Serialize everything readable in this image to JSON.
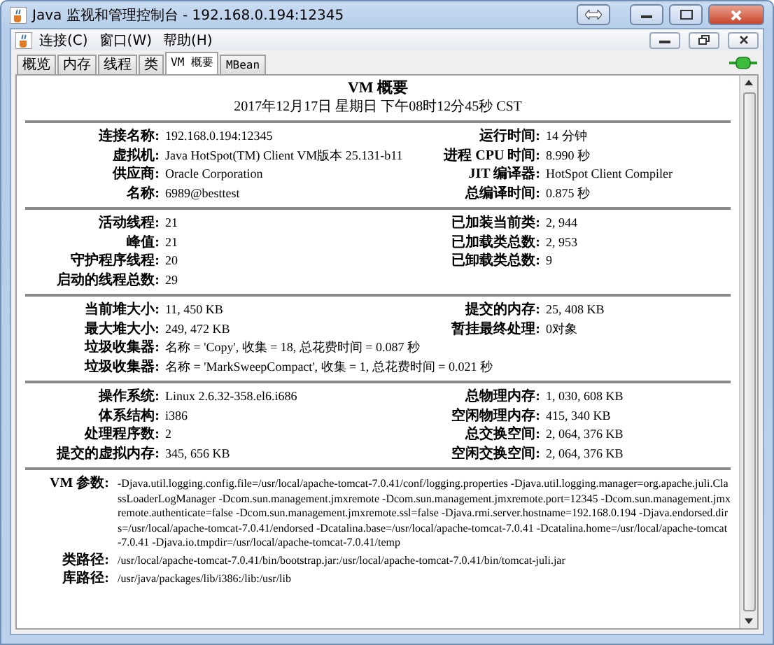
{
  "window": {
    "title": "Java 监视和管理控制台 - 192.168.0.194:12345"
  },
  "menu": [
    {
      "label": "连接(C)"
    },
    {
      "label": "窗口(W)"
    },
    {
      "label": "帮助(H)"
    }
  ],
  "tabs": [
    {
      "label": "概览",
      "selected": false
    },
    {
      "label": "内存",
      "selected": false
    },
    {
      "label": "线程",
      "selected": false
    },
    {
      "label": "类",
      "selected": false
    },
    {
      "label": "VM 概要",
      "selected": true
    },
    {
      "label": "MBean",
      "selected": false
    }
  ],
  "summary": {
    "title": "VM 概要",
    "timestamp": "2017年12月17日 星期日 下午08时12分45秒 CST",
    "sections": [
      {
        "rows": [
          {
            "kind": "pair",
            "left": {
              "label": "连接名称:",
              "value": "192.168.0.194:12345"
            },
            "right": {
              "label": "运行时间:",
              "value": "14 分钟"
            }
          },
          {
            "kind": "pair",
            "left": {
              "label": "虚拟机:",
              "value": "Java HotSpot(TM) Client VM版本 25.131-b11"
            },
            "right": {
              "label": "进程 CPU 时间:",
              "value": "8.990 秒"
            }
          },
          {
            "kind": "pair",
            "left": {
              "label": "供应商:",
              "value": "Oracle Corporation"
            },
            "right": {
              "label": "JIT 编译器:",
              "value": "HotSpot Client Compiler"
            }
          },
          {
            "kind": "pair",
            "left": {
              "label": "名称:",
              "value": "6989@besttest"
            },
            "right": {
              "label": "总编译时间:",
              "value": "0.875 秒"
            }
          }
        ]
      },
      {
        "rows": [
          {
            "kind": "pair",
            "left": {
              "label": "活动线程:",
              "value": "21"
            },
            "right": {
              "label": "已加装当前类:",
              "value": "2, 944"
            }
          },
          {
            "kind": "pair",
            "left": {
              "label": "峰值:",
              "value": "21"
            },
            "right": {
              "label": "已加载类总数:",
              "value": "2, 953"
            }
          },
          {
            "kind": "pair",
            "left": {
              "label": "守护程序线程:",
              "value": "20"
            },
            "right": {
              "label": "已卸载类总数:",
              "value": "9"
            }
          },
          {
            "kind": "pair",
            "left": {
              "label": "启动的线程总数:",
              "value": "29"
            }
          }
        ]
      },
      {
        "rows": [
          {
            "kind": "pair",
            "left": {
              "label": "当前堆大小:",
              "value": "11, 450 KB"
            },
            "right": {
              "label": "提交的内存:",
              "value": "25, 408 KB"
            }
          },
          {
            "kind": "pair",
            "left": {
              "label": "最大堆大小:",
              "value": "249, 472 KB"
            },
            "right": {
              "label": "暂挂最终处理:",
              "value": "0对象"
            }
          },
          {
            "kind": "full",
            "left": {
              "label": "垃圾收集器:",
              "value": "名称 = 'Copy', 收集 = 18, 总花费时间 = 0.087 秒"
            }
          },
          {
            "kind": "full",
            "left": {
              "label": "垃圾收集器:",
              "value": "名称 = 'MarkSweepCompact', 收集 = 1, 总花费时间 = 0.021 秒"
            }
          }
        ]
      },
      {
        "rows": [
          {
            "kind": "pair",
            "left": {
              "label": "操作系统:",
              "value": "Linux 2.6.32-358.el6.i686"
            },
            "right": {
              "label": "总物理内存:",
              "value": "1, 030, 608 KB"
            }
          },
          {
            "kind": "pair",
            "left": {
              "label": "体系结构:",
              "value": "i386"
            },
            "right": {
              "label": "空闲物理内存:",
              "value": "415, 340 KB"
            }
          },
          {
            "kind": "pair",
            "left": {
              "label": "处理程序数:",
              "value": "2"
            },
            "right": {
              "label": "总交换空间:",
              "value": "2, 064, 376 KB"
            }
          },
          {
            "kind": "pair",
            "left": {
              "label": "提交的虚拟内存:",
              "value": "345, 656 KB"
            },
            "right": {
              "label": "空闲交换空间:",
              "value": "2, 064, 376 KB"
            }
          }
        ]
      },
      {
        "rows": [
          {
            "kind": "long",
            "left": {
              "label": "VM 参数:",
              "value": "-Djava.util.logging.config.file=/usr/local/apache-tomcat-7.0.41/conf/logging.properties -Djava.util.logging.manager=org.apache.juli.ClassLoaderLogManager -Dcom.sun.management.jmxremote -Dcom.sun.management.jmxremote.port=12345 -Dcom.sun.management.jmxremote.authenticate=false -Dcom.sun.management.jmxremote.ssl=false -Djava.rmi.server.hostname=192.168.0.194 -Djava.endorsed.dirs=/usr/local/apache-tomcat-7.0.41/endorsed -Dcatalina.base=/usr/local/apache-tomcat-7.0.41 -Dcatalina.home=/usr/local/apache-tomcat-7.0.41 -Djava.io.tmpdir=/usr/local/apache-tomcat-7.0.41/temp"
            }
          },
          {
            "kind": "long",
            "left": {
              "label": "类路径:",
              "value": "/usr/local/apache-tomcat-7.0.41/bin/bootstrap.jar:/usr/local/apache-tomcat-7.0.41/bin/tomcat-juli.jar"
            }
          },
          {
            "kind": "long",
            "left": {
              "label": "库路径:",
              "value": "/usr/java/packages/lib/i386:/lib:/usr/lib"
            }
          }
        ]
      }
    ]
  }
}
